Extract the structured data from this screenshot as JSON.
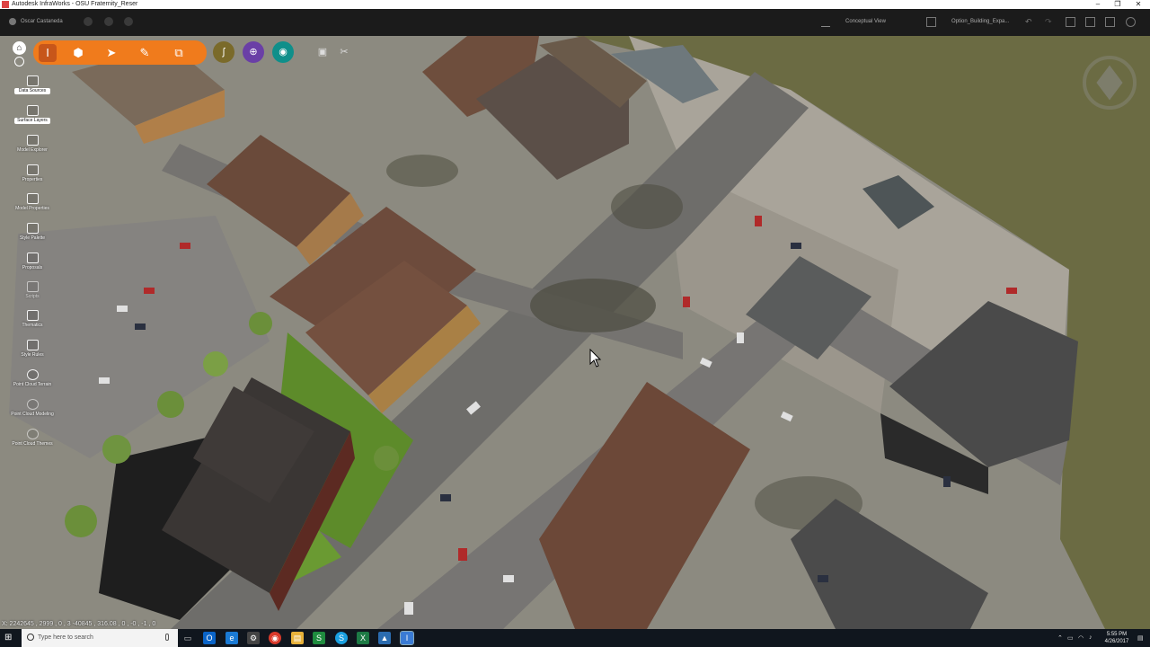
{
  "window": {
    "title": "Autodesk InfraWorks - OSU Fraternity_Reser",
    "controls": [
      "–",
      "❐",
      "✕"
    ]
  },
  "appbar": {
    "user_name": "Oscar Castaneda",
    "view_label": "Conceptual View",
    "proposal_label": "Option_Building_Expa..."
  },
  "toolbar": {
    "buttons": [
      {
        "name": "infraworks",
        "glyph": "I"
      },
      {
        "name": "build-manage",
        "glyph": "⬢"
      },
      {
        "name": "select",
        "glyph": "➤"
      },
      {
        "name": "sketch",
        "glyph": "✎"
      },
      {
        "name": "share",
        "glyph": "⧉"
      }
    ],
    "circle_buttons": [
      {
        "name": "design-roads",
        "glyph": "ʃ",
        "color": "#7a6a2a"
      },
      {
        "name": "analyze",
        "glyph": "⊕",
        "color": "#6a3fa6"
      },
      {
        "name": "present",
        "glyph": "◉",
        "color": "#0f8f8a"
      }
    ]
  },
  "left_panel": {
    "items": [
      {
        "label": "Data Sources",
        "boxed": true
      },
      {
        "label": "Surface Layers",
        "boxed": true
      },
      {
        "label": "Model Explorer",
        "boxed": false
      },
      {
        "label": "Properties",
        "boxed": false
      },
      {
        "label": "Model Properties",
        "boxed": false
      },
      {
        "label": "Style Palette",
        "boxed": false
      },
      {
        "label": "Proposals",
        "boxed": false
      },
      {
        "label": "Scripts",
        "boxed": false
      },
      {
        "label": "Thematics",
        "boxed": false
      },
      {
        "label": "Style Rules",
        "boxed": false
      },
      {
        "label": "Point Cloud Terrain",
        "boxed": false
      },
      {
        "label": "Point Cloud Modeling",
        "boxed": false
      },
      {
        "label": "Point Cloud Themes",
        "boxed": false
      }
    ]
  },
  "status": {
    "coordinates": "X: 2242645 , 2999 , 0 , 3  -40845 , 316.08 , 0 , -0 , -1 , 0"
  },
  "taskbar": {
    "search_placeholder": "Type here to search",
    "time": "5:55 PM",
    "date": "4/26/2017",
    "apps": [
      {
        "name": "task-view",
        "glyph": "▭",
        "color": "#10161e"
      },
      {
        "name": "outlook",
        "glyph": "O",
        "color": "#0a64c8"
      },
      {
        "name": "edge",
        "glyph": "e",
        "color": "#1a7ad4"
      },
      {
        "name": "settings",
        "glyph": "⚙",
        "color": "#444"
      },
      {
        "name": "chrome",
        "glyph": "◉",
        "color": "#d93a2b"
      },
      {
        "name": "file-explorer",
        "glyph": "▤",
        "color": "#e8b23a"
      },
      {
        "name": "sharepoint",
        "glyph": "S",
        "color": "#1f8c3f"
      },
      {
        "name": "skype",
        "glyph": "S",
        "color": "#1aa0e0"
      },
      {
        "name": "excel",
        "glyph": "X",
        "color": "#1d7a45"
      },
      {
        "name": "infraworks-preview",
        "glyph": "▲",
        "color": "#2b6cb0"
      },
      {
        "name": "infraworks",
        "glyph": "I",
        "color": "#3a7bd5"
      }
    ]
  }
}
